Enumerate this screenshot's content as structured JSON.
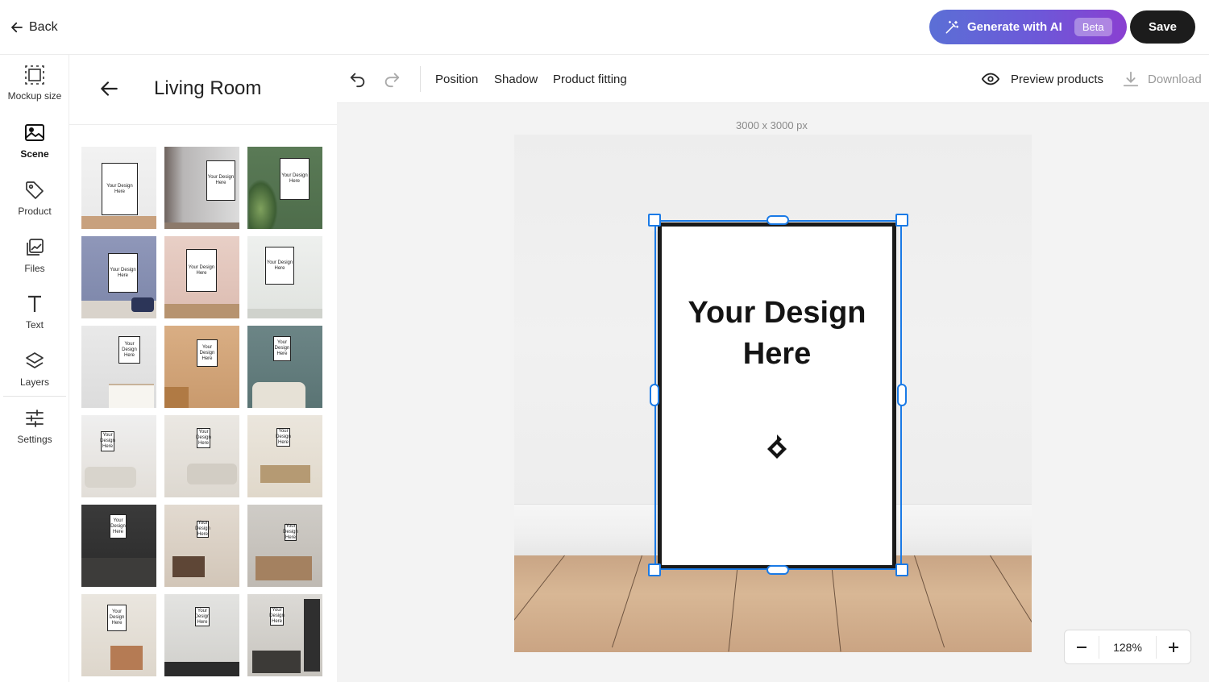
{
  "header": {
    "back_label": "Back",
    "ai_label": "Generate with AI",
    "beta_label": "Beta",
    "save_label": "Save"
  },
  "rail": {
    "items": [
      {
        "label": "Mockup size",
        "icon": "mockup-size-icon"
      },
      {
        "label": "Scene",
        "icon": "image-icon"
      },
      {
        "label": "Product",
        "icon": "tag-icon"
      },
      {
        "label": "Files",
        "icon": "files-icon"
      },
      {
        "label": "Text",
        "icon": "text-icon"
      },
      {
        "label": "Layers",
        "icon": "layers-icon"
      },
      {
        "label": "Settings",
        "icon": "sliders-icon"
      }
    ]
  },
  "panel": {
    "title": "Living Room",
    "thumb_text": "Your Design Here"
  },
  "toolbar": {
    "position_label": "Position",
    "shadow_label": "Shadow",
    "fitting_label": "Product fitting",
    "preview_label": "Preview products",
    "download_label": "Download"
  },
  "canvas": {
    "size_label": "3000 x 3000 px",
    "design_text": "Your Design Here"
  },
  "zoom": {
    "value": "128%"
  },
  "colors": {
    "accent": "#1a7ae6",
    "ai_gradient_start": "#5b6fd6",
    "ai_gradient_end": "#8a3fd1",
    "save_bg": "#1c1c1c"
  }
}
